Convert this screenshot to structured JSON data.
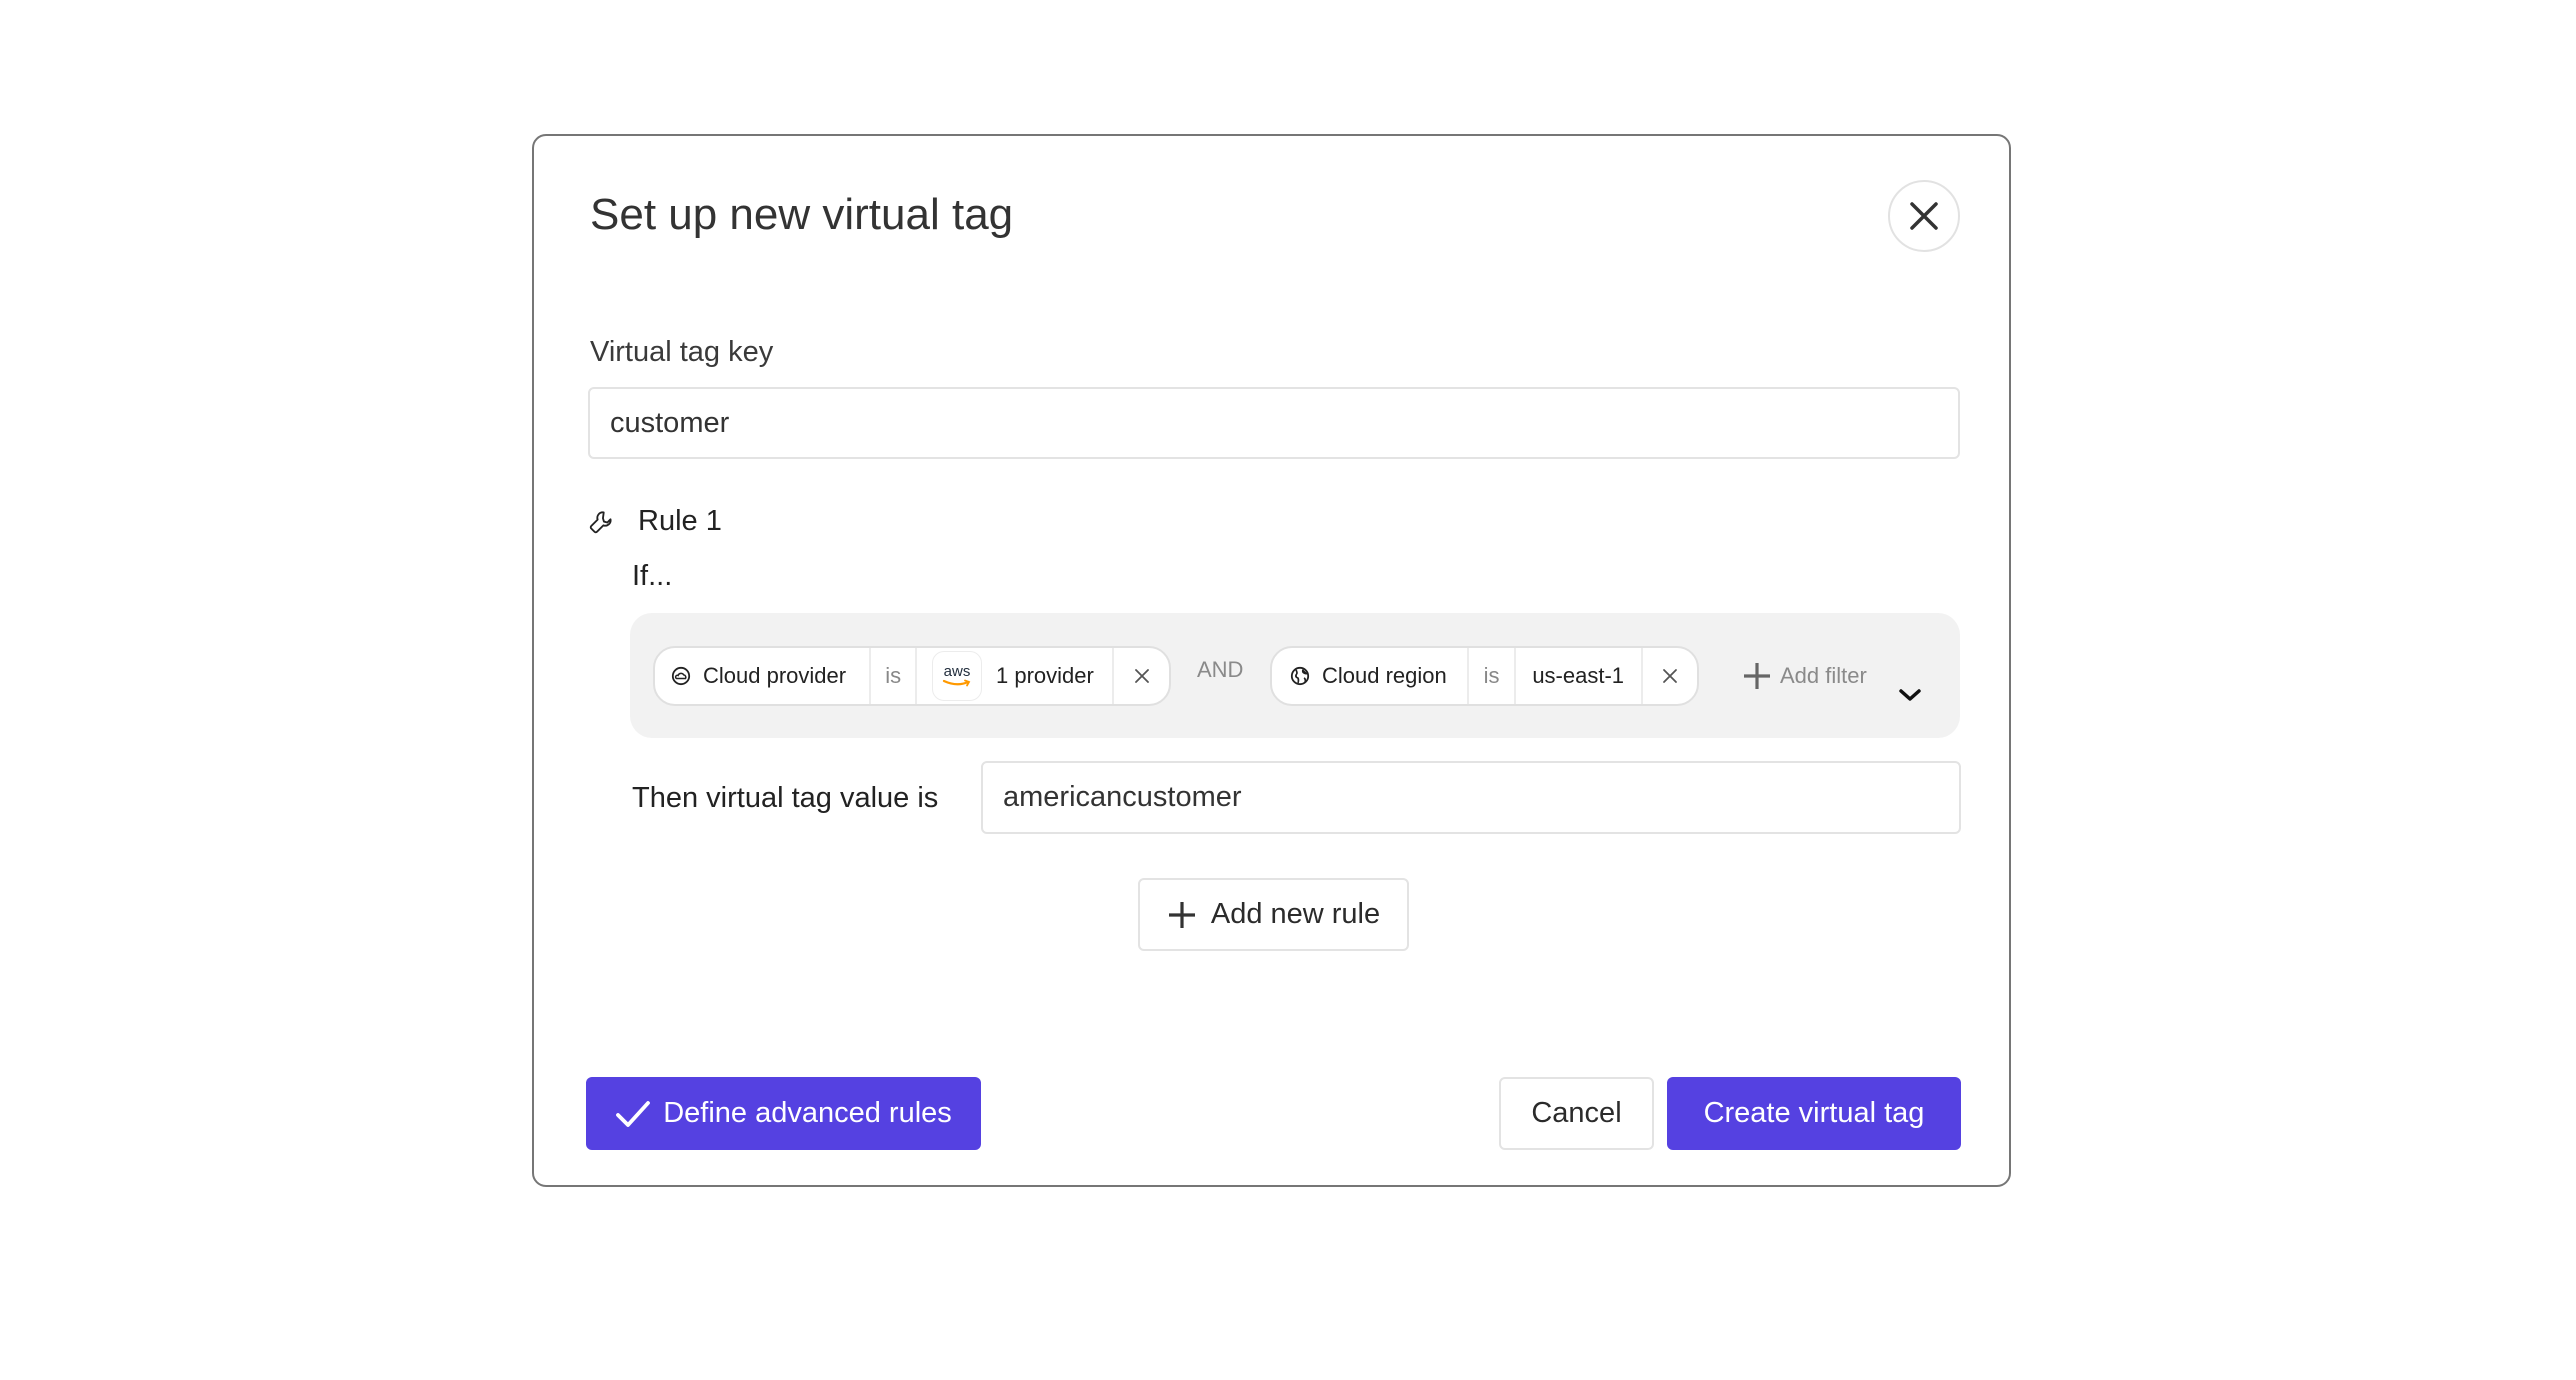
{
  "dialog": {
    "title": "Set up new virtual tag",
    "close_icon": "close-icon"
  },
  "tag_key": {
    "label": "Virtual tag key",
    "value": "customer"
  },
  "rules": [
    {
      "icon": "wrench-icon",
      "title": "Rule 1",
      "if_label": "If...",
      "filters": [
        {
          "icon": "cloud-icon",
          "field": "Cloud provider",
          "operator": "is",
          "value_icon": "aws-logo",
          "value_logo_text": "aws",
          "value": "1 provider",
          "remove_icon": "close-icon"
        },
        {
          "icon": "globe-icon",
          "field": "Cloud region",
          "operator": "is",
          "value": "us-east-1",
          "remove_icon": "close-icon"
        }
      ],
      "conjunction": "AND",
      "add_filter_label": "Add filter",
      "then_label": "Then virtual tag value is",
      "then_value": "americancustomer"
    }
  ],
  "add_rule_label": "Add new rule",
  "footer": {
    "advanced_label": "Define advanced rules",
    "cancel_label": "Cancel",
    "create_label": "Create virtual tag"
  },
  "colors": {
    "primary": "#5541e1",
    "filter_bg": "#f2f2f2",
    "border": "#767676"
  }
}
